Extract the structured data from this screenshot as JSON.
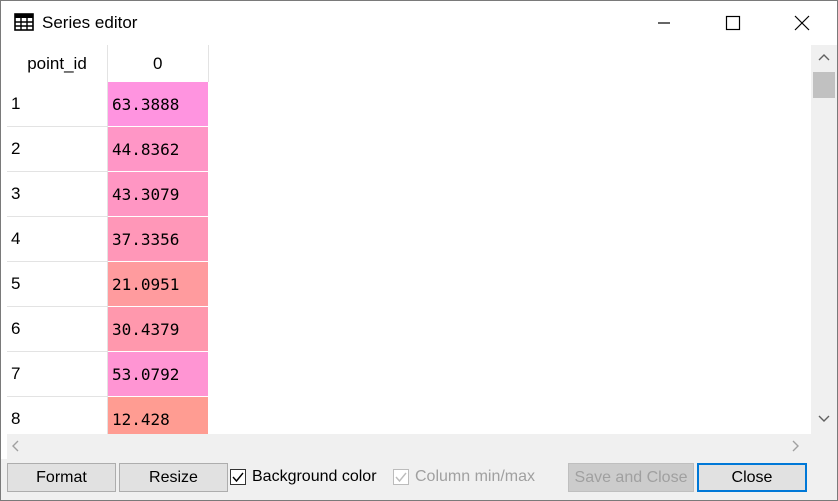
{
  "window": {
    "title": "Series editor",
    "icon": "table-icon",
    "controls": [
      "minimize-icon",
      "maximize-icon",
      "close-icon"
    ]
  },
  "grid": {
    "columns": [
      "point_id",
      "0"
    ],
    "rows": [
      {
        "id": "1",
        "value": "63.3888",
        "color": "#ff94e0"
      },
      {
        "id": "2",
        "value": "44.8362",
        "color": "#ff96c6"
      },
      {
        "id": "3",
        "value": "43.3079",
        "color": "#ff96c3"
      },
      {
        "id": "4",
        "value": "37.3356",
        "color": "#ff97b8"
      },
      {
        "id": "5",
        "value": "21.0951",
        "color": "#ff9b9e"
      },
      {
        "id": "6",
        "value": "30.4379",
        "color": "#ff98ad"
      },
      {
        "id": "7",
        "value": "53.0792",
        "color": "#ff95d3"
      },
      {
        "id": "8",
        "value": "12.428",
        "color": "#ff9c92"
      }
    ]
  },
  "toolbar": {
    "format_label": "Format",
    "resize_label": "Resize",
    "background_color_label": "Background color",
    "background_color_checked": true,
    "column_minmax_label": "Column min/max",
    "column_minmax_checked": true,
    "column_minmax_enabled": false,
    "save_close_label": "Save and Close",
    "save_close_enabled": false,
    "close_label": "Close"
  }
}
